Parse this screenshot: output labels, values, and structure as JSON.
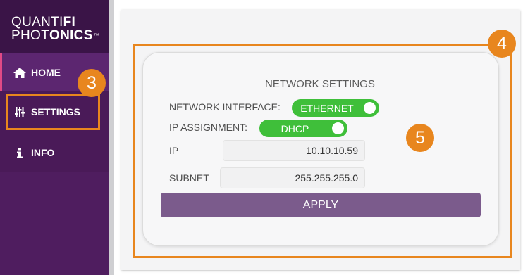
{
  "brand": {
    "line1_light": "QUANTI",
    "line1_bold": "FI",
    "line2_light": "PHOT",
    "line2_bold": "ONICS",
    "trademark": "™"
  },
  "sidebar": {
    "items": [
      {
        "label": "HOME",
        "icon": "home-icon"
      },
      {
        "label": "SETTINGS",
        "icon": "sliders-icon"
      },
      {
        "label": "INFO",
        "icon": "info-icon"
      }
    ]
  },
  "network": {
    "title": "NETWORK SETTINGS",
    "interface_label": "NETWORK INTERFACE:",
    "interface_value": "ETHERNET",
    "assignment_label": "IP ASSIGNMENT:",
    "assignment_value": "DHCP",
    "ip_label": "IP",
    "ip_value": "10.10.10.59",
    "subnet_label": "SUBNET",
    "subnet_value": "255.255.255.0",
    "apply_label": "APPLY"
  },
  "annotations": {
    "settings_badge": "3",
    "panel_badge": "4",
    "card_badge": "5"
  },
  "colors": {
    "sidebar": "#4a1a58",
    "toggle_on": "#3fbf3a",
    "apply_button": "#7b5b8c",
    "annotation": "#e8861e"
  }
}
